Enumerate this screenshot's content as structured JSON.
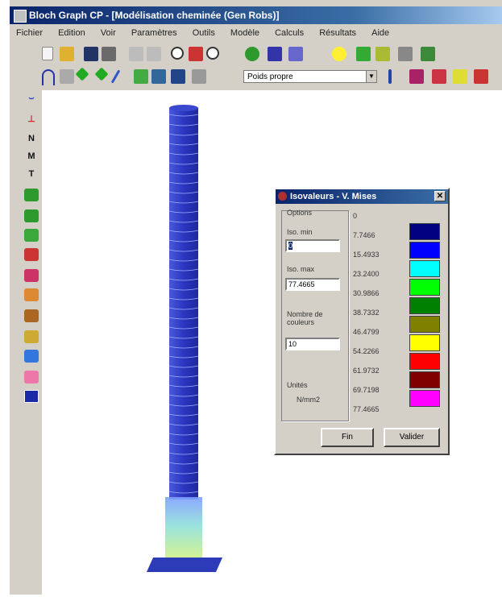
{
  "window": {
    "title": "Bloch Graph CP - [Modélisation cheminée (Gen Robs)]"
  },
  "menu": [
    "Fichier",
    "Edition",
    "Voir",
    "Paramètres",
    "Outils",
    "Modèle",
    "Calculs",
    "Résultats",
    "Aide"
  ],
  "toolbar": {
    "load_case": "Poids propre",
    "icons": [
      "new-icon",
      "open-icon",
      "save-icon",
      "print-icon",
      "undo-icon",
      "redo-icon",
      "zoom-icon",
      "zoom-window-icon",
      "zoom-extents-icon",
      "refresh-icon",
      "render-icon",
      "color-icon"
    ]
  },
  "left_toolbar": {
    "items": [
      "support",
      "N",
      "M",
      "T",
      "shell-1",
      "shell-2",
      "shell-3",
      "shell-4",
      "shell-5",
      "shell-6",
      "shell-7",
      "shell-8",
      "shell-9",
      "section"
    ]
  },
  "dialog": {
    "title": "Isovaleurs - V. Mises",
    "options_label": "Options",
    "min_label": "Iso. min",
    "min_value": "0",
    "max_label": "Iso. max",
    "max_value": "77.4665",
    "ncolors_label": "Nombre de couleurs",
    "ncolors_value": "10",
    "units_label": "Unités",
    "units_value": "N/mm2",
    "close_icon": "close-icon",
    "values": [
      "0",
      "7.7466",
      "15.4933",
      "23.2400",
      "30.9866",
      "38.7332",
      "46.4799",
      "54.2266",
      "61.9732",
      "69.7198",
      "77.4665"
    ],
    "colors": [
      "#000080",
      "#0000ff",
      "#00ffff",
      "#00ff00",
      "#008000",
      "#808000",
      "#ffff00",
      "#ff0000",
      "#800000",
      "#ff00ff"
    ],
    "fin_label": "Fin",
    "validate_label": "Valider"
  }
}
